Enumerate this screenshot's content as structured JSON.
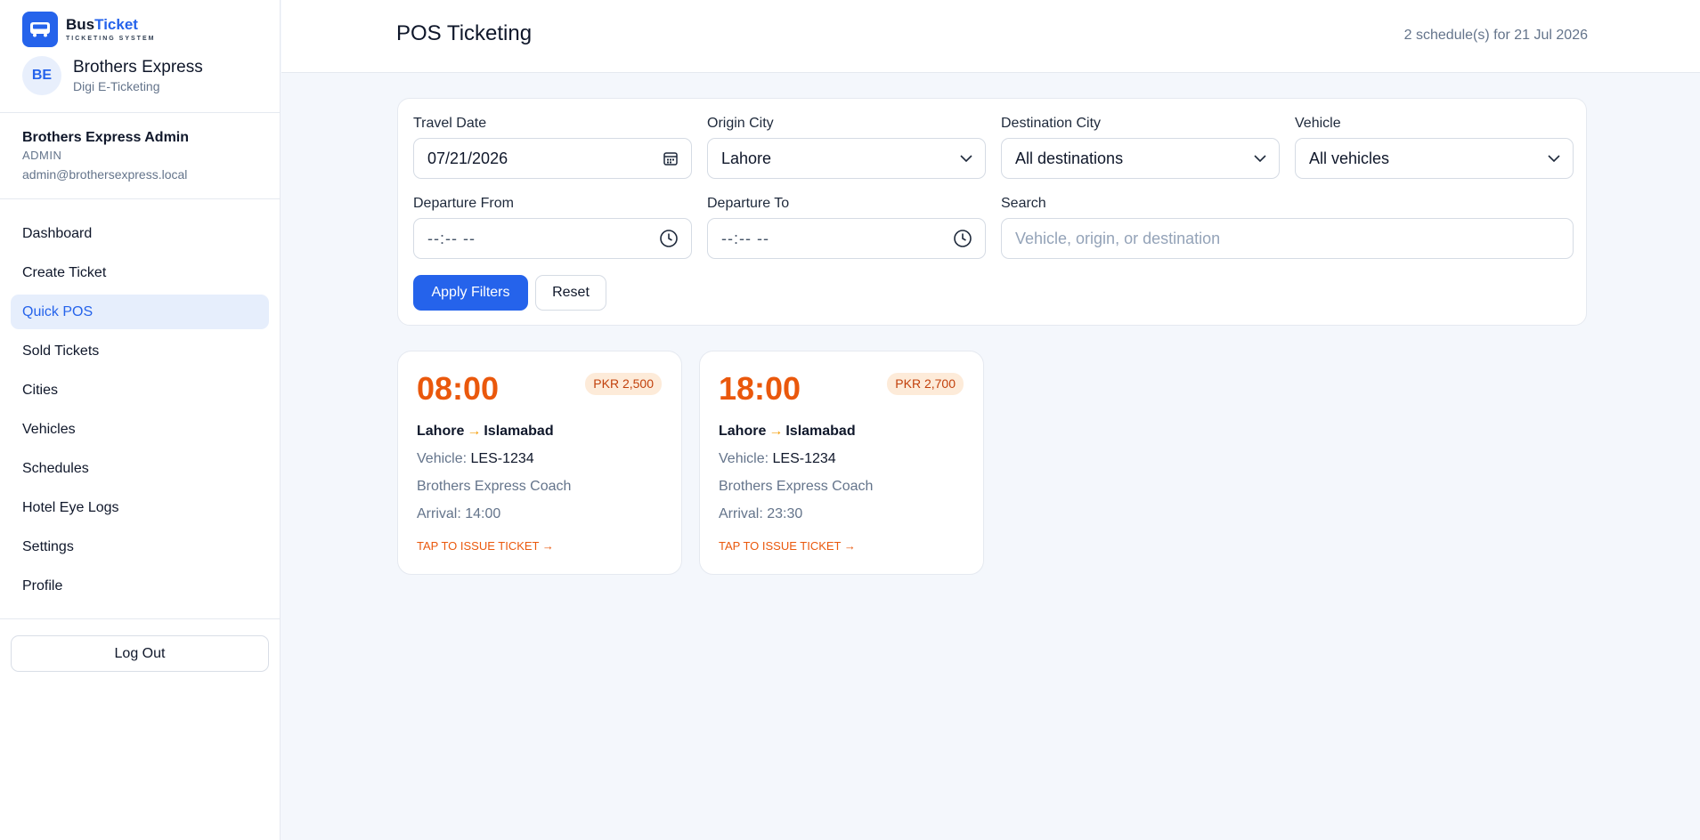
{
  "brand": {
    "name_part1": "Bus",
    "name_part2": "Ticket",
    "subtitle": "TICKETING SYSTEM",
    "logo_icon": "bus-icon"
  },
  "org": {
    "initials": "BE",
    "name": "Brothers Express",
    "subtitle": "Digi E-Ticketing"
  },
  "user": {
    "name": "Brothers Express Admin",
    "role": "ADMIN",
    "email": "admin@brothersexpress.local"
  },
  "nav": {
    "items": [
      {
        "label": "Dashboard",
        "active": false
      },
      {
        "label": "Create Ticket",
        "active": false
      },
      {
        "label": "Quick POS",
        "active": true
      },
      {
        "label": "Sold Tickets",
        "active": false
      },
      {
        "label": "Cities",
        "active": false
      },
      {
        "label": "Vehicles",
        "active": false
      },
      {
        "label": "Schedules",
        "active": false
      },
      {
        "label": "Hotel Eye Logs",
        "active": false
      },
      {
        "label": "Settings",
        "active": false
      },
      {
        "label": "Profile",
        "active": false
      }
    ],
    "logout_label": "Log Out"
  },
  "header": {
    "title": "POS Ticketing",
    "meta": "2 schedule(s) for 21 Jul 2026"
  },
  "filters": {
    "travel_date": {
      "label": "Travel Date",
      "value": "07/21/2026",
      "icon": "calendar-icon"
    },
    "origin_city": {
      "label": "Origin City",
      "value": "Lahore",
      "icon": "chevron-down-icon"
    },
    "destination_city": {
      "label": "Destination City",
      "value": "All destinations",
      "icon": "chevron-down-icon"
    },
    "vehicle": {
      "label": "Vehicle",
      "value": "All vehicles",
      "icon": "chevron-down-icon"
    },
    "departure_from": {
      "label": "Departure From",
      "value": "--:-- --",
      "icon": "clock-icon"
    },
    "departure_to": {
      "label": "Departure To",
      "value": "--:-- --",
      "icon": "clock-icon"
    },
    "search": {
      "label": "Search",
      "placeholder": "Vehicle, origin, or destination",
      "value": ""
    },
    "apply_label": "Apply Filters",
    "reset_label": "Reset"
  },
  "schedules": [
    {
      "time": "08:00",
      "price": "PKR 2,500",
      "origin": "Lahore",
      "arrow": "→",
      "destination": "Islamabad",
      "vehicle_label": "Vehicle:",
      "vehicle": "LES-1234",
      "coach": "Brothers Express Coach",
      "arrival": "Arrival: 14:00",
      "cta": "TAP TO ISSUE TICKET →"
    },
    {
      "time": "18:00",
      "price": "PKR 2,700",
      "origin": "Lahore",
      "arrow": "→",
      "destination": "Islamabad",
      "vehicle_label": "Vehicle:",
      "vehicle": "LES-1234",
      "coach": "Brothers Express Coach",
      "arrival": "Arrival: 23:30",
      "cta": "TAP TO ISSUE TICKET →"
    }
  ],
  "colors": {
    "accent": "#2563eb",
    "orange": "#ea580c",
    "price_bg": "#fdebd9",
    "bg": "#f4f7fc"
  }
}
